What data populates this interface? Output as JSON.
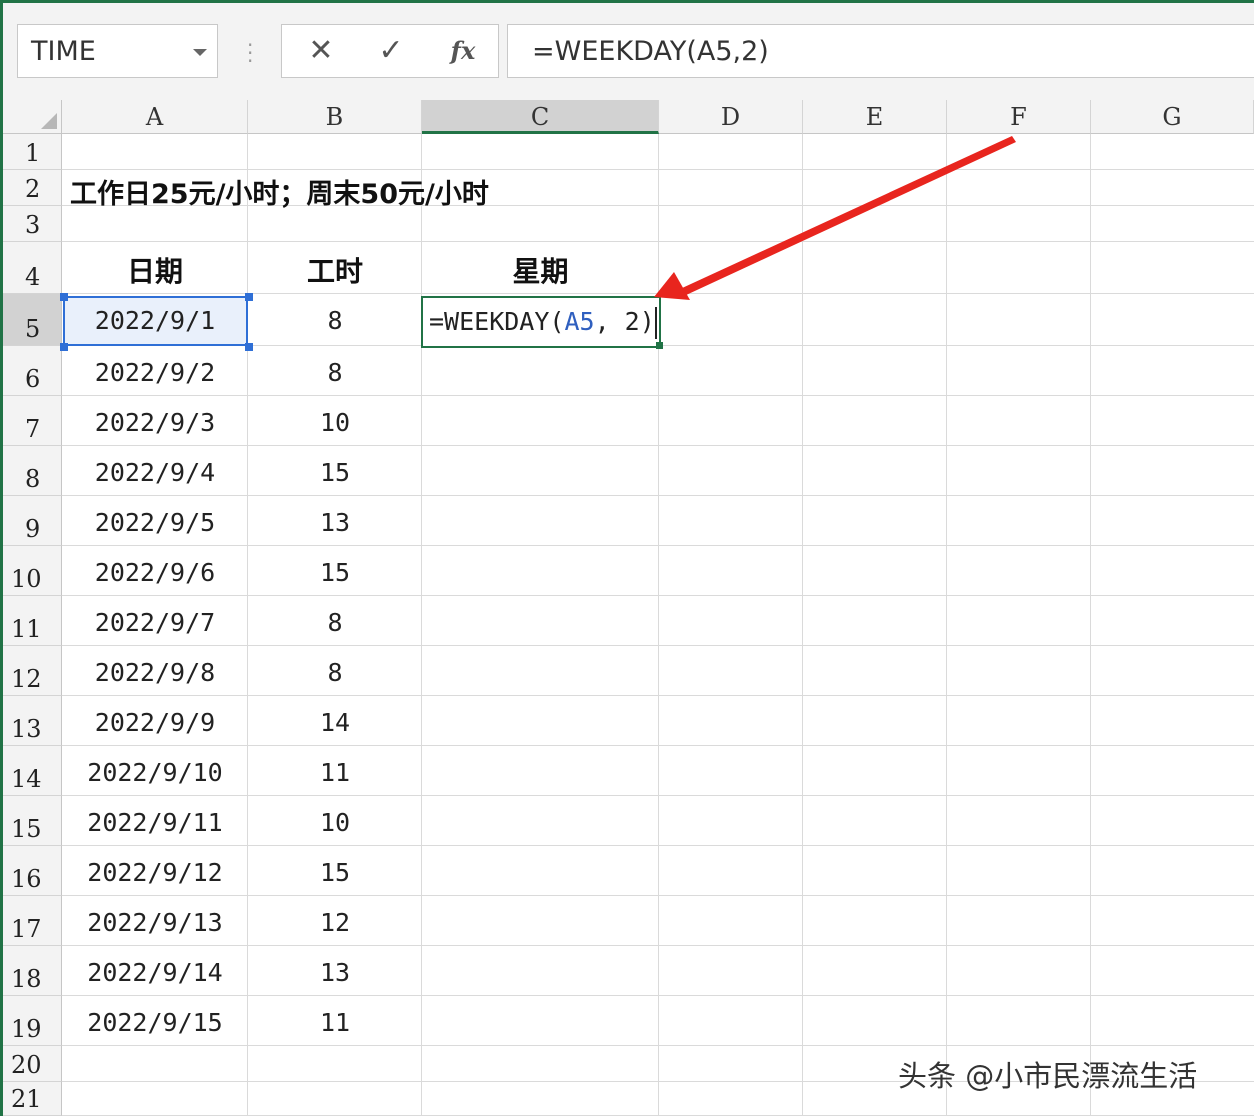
{
  "formula_bar": {
    "name_box": "TIME",
    "cancel_symbol": "✕",
    "confirm_symbol": "✓",
    "fx_symbol": "fx",
    "formula": "=WEEKDAY(A5,2)"
  },
  "columns": [
    "A",
    "B",
    "C",
    "D",
    "E",
    "F",
    "G"
  ],
  "active_column": "C",
  "rows": [
    "1",
    "2",
    "3",
    "4",
    "5",
    "6",
    "7",
    "8",
    "9",
    "10",
    "11",
    "12",
    "13",
    "14",
    "15",
    "16",
    "17",
    "18",
    "19",
    "20",
    "21"
  ],
  "active_row": "5",
  "sheet": {
    "title": "工作日25元/小时；周末50元/小时",
    "headers": {
      "date": "日期",
      "hours": "工时",
      "weekday": "星期"
    },
    "data_rows": [
      {
        "date": "2022/9/1",
        "hours": "8"
      },
      {
        "date": "2022/9/2",
        "hours": "8"
      },
      {
        "date": "2022/9/3",
        "hours": "10"
      },
      {
        "date": "2022/9/4",
        "hours": "15"
      },
      {
        "date": "2022/9/5",
        "hours": "13"
      },
      {
        "date": "2022/9/6",
        "hours": "15"
      },
      {
        "date": "2022/9/7",
        "hours": "8"
      },
      {
        "date": "2022/9/8",
        "hours": "8"
      },
      {
        "date": "2022/9/9",
        "hours": "14"
      },
      {
        "date": "2022/9/10",
        "hours": "11"
      },
      {
        "date": "2022/9/11",
        "hours": "10"
      },
      {
        "date": "2022/9/12",
        "hours": "15"
      },
      {
        "date": "2022/9/13",
        "hours": "12"
      },
      {
        "date": "2022/9/14",
        "hours": "13"
      },
      {
        "date": "2022/9/15",
        "hours": "11"
      }
    ],
    "editing": {
      "prefix": "=WEEKDAY(",
      "ref": "A5",
      "suffix": ", 2)"
    }
  },
  "watermark": "头条 @小市民漂流生活",
  "colors": {
    "accent": "#217346",
    "selection": "#2f6fd6",
    "arrow": "#e8251e"
  }
}
